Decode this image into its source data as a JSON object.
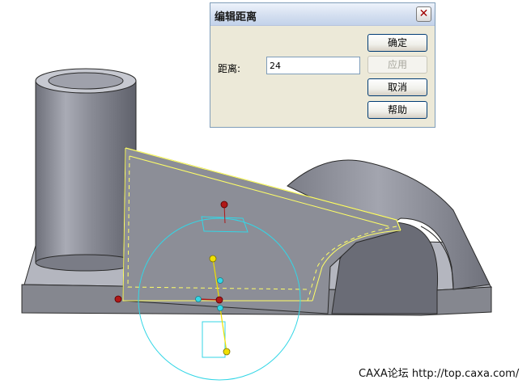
{
  "dialog": {
    "title": "编辑距离",
    "close_symbol": "✕",
    "field_label": "距离:",
    "field_value": "24",
    "buttons": {
      "ok": "确定",
      "apply": "应用",
      "cancel": "取消",
      "help": "帮助"
    }
  },
  "watermark": {
    "text": "CAXA论坛 http://top.caxa.com/"
  },
  "colors": {
    "part_face": "#8c8e97",
    "part_top": "#b4b6bf",
    "selection_outline": "#ffff66",
    "guide_circle": "#33d6e6",
    "handle_red": "#b01818",
    "handle_cyan": "#33d6e6",
    "handle_yellow": "#f0e000"
  }
}
